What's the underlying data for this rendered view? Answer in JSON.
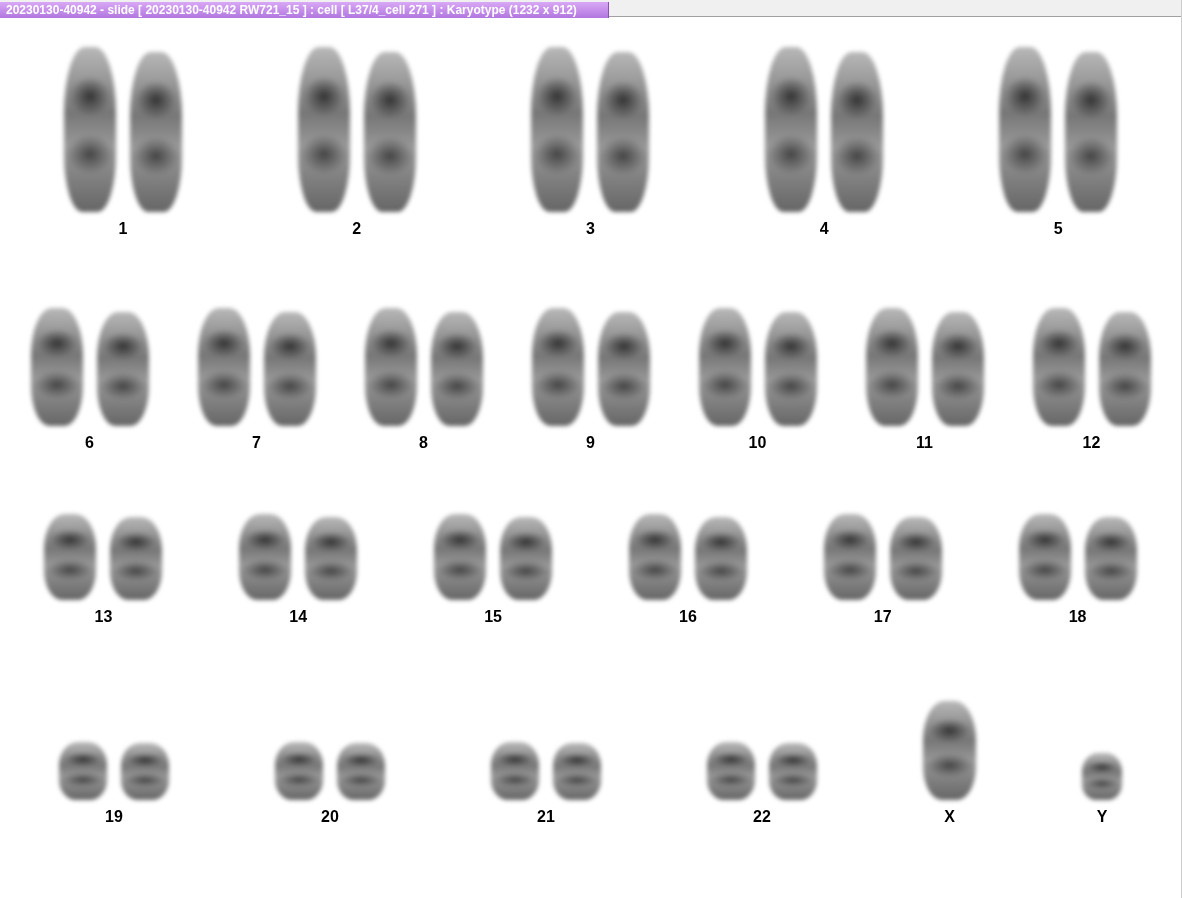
{
  "window": {
    "title": "20230130-40942 - slide [ 20230130-40942 RW721_15 ] : cell [ L37/4_cell 271 ] : Karyotype  (1232 x 912)"
  },
  "karyotype_rows": [
    {
      "chromosomes": [
        {
          "label": "1",
          "kind": "pair"
        },
        {
          "label": "2",
          "kind": "pair"
        },
        {
          "label": "3",
          "kind": "pair"
        },
        {
          "label": "4",
          "kind": "pair"
        },
        {
          "label": "5",
          "kind": "pair"
        }
      ]
    },
    {
      "chromosomes": [
        {
          "label": "6",
          "kind": "pair"
        },
        {
          "label": "7",
          "kind": "pair"
        },
        {
          "label": "8",
          "kind": "pair"
        },
        {
          "label": "9",
          "kind": "pair"
        },
        {
          "label": "10",
          "kind": "pair"
        },
        {
          "label": "11",
          "kind": "pair"
        },
        {
          "label": "12",
          "kind": "pair"
        }
      ]
    },
    {
      "chromosomes": [
        {
          "label": "13",
          "kind": "pair"
        },
        {
          "label": "14",
          "kind": "pair"
        },
        {
          "label": "15",
          "kind": "pair"
        },
        {
          "label": "16",
          "kind": "pair"
        },
        {
          "label": "17",
          "kind": "pair"
        },
        {
          "label": "18",
          "kind": "pair"
        }
      ]
    },
    {
      "chromosomes": [
        {
          "label": "19",
          "kind": "pair"
        },
        {
          "label": "20",
          "kind": "pair"
        },
        {
          "label": "21",
          "kind": "pair"
        },
        {
          "label": "22",
          "kind": "pair"
        },
        {
          "label": "X",
          "kind": "single"
        },
        {
          "label": "Y",
          "kind": "single"
        }
      ]
    }
  ]
}
